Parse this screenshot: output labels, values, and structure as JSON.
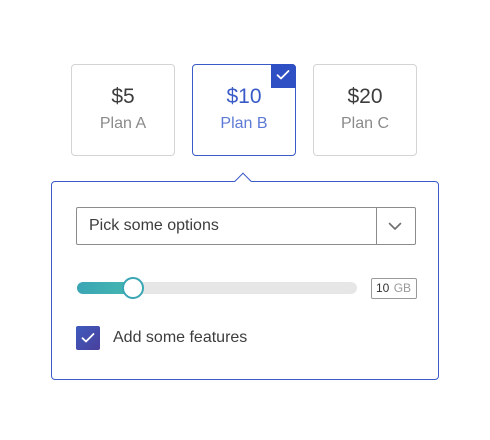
{
  "plans": [
    {
      "price": "$5",
      "name": "Plan A",
      "selected": false
    },
    {
      "price": "$10",
      "name": "Plan B",
      "selected": true
    },
    {
      "price": "$20",
      "name": "Plan C",
      "selected": false
    }
  ],
  "options_select": {
    "value": "Pick some options",
    "icon": "chevron-down-icon"
  },
  "storage_slider": {
    "value": "10",
    "unit": "GB",
    "fill_fraction": 0.2
  },
  "features_checkbox": {
    "label": "Add some features",
    "checked": true,
    "icon": "checkmark-icon"
  },
  "colors": {
    "accent": "#3a5bc7",
    "badge": "#2f4fc4",
    "slider_fill": "#3aa6b4",
    "checkbox": "#3d5bbd"
  }
}
